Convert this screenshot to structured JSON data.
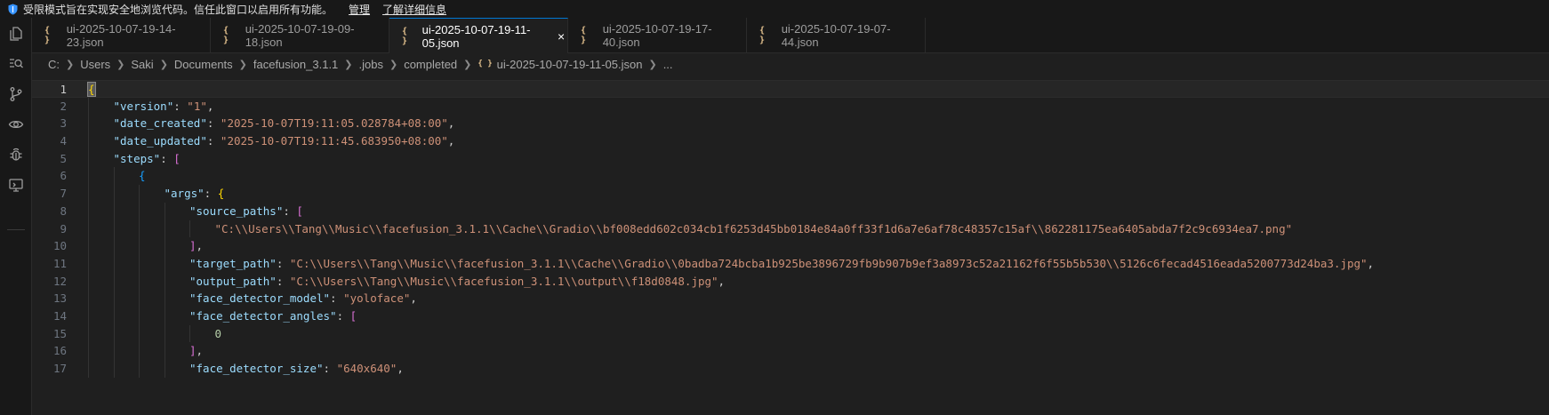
{
  "banner": {
    "message": "受限模式旨在实现安全地浏览代码。信任此窗口以启用所有功能。",
    "manage": "管理",
    "learn_more": "了解详细信息"
  },
  "activity_bar": [
    "explorer-icon",
    "search-icon",
    "source-control-icon",
    "eye-icon",
    "debug-icon",
    "remote-explorer-icon"
  ],
  "tabs": [
    {
      "label": "ui-2025-10-07-19-14-23.json",
      "active": false
    },
    {
      "label": "ui-2025-10-07-19-09-18.json",
      "active": false
    },
    {
      "label": "ui-2025-10-07-19-11-05.json",
      "active": true
    },
    {
      "label": "ui-2025-10-07-19-17-40.json",
      "active": false
    },
    {
      "label": "ui-2025-10-07-19-07-44.json",
      "active": false
    }
  ],
  "tab_icon": "{ }",
  "close_glyph": "×",
  "breadcrumb": [
    "C:",
    "Users",
    "Saki",
    "Documents",
    "facefusion_3.1.1",
    ".jobs",
    "completed",
    "ui-2025-10-07-19-11-05.json",
    "..."
  ],
  "editor": {
    "current_line": 1,
    "lines": [
      {
        "n": "1",
        "indent": 0,
        "tokens": [
          [
            "b1",
            "{"
          ]
        ]
      },
      {
        "n": "2",
        "indent": 1,
        "tokens": [
          [
            "k",
            "\"version\""
          ],
          [
            "p",
            ": "
          ],
          [
            "s",
            "\"1\""
          ],
          [
            "p",
            ","
          ]
        ]
      },
      {
        "n": "3",
        "indent": 1,
        "tokens": [
          [
            "k",
            "\"date_created\""
          ],
          [
            "p",
            ": "
          ],
          [
            "s",
            "\"2025-10-07T19:11:05.028784+08:00\""
          ],
          [
            "p",
            ","
          ]
        ]
      },
      {
        "n": "4",
        "indent": 1,
        "tokens": [
          [
            "k",
            "\"date_updated\""
          ],
          [
            "p",
            ": "
          ],
          [
            "s",
            "\"2025-10-07T19:11:45.683950+08:00\""
          ],
          [
            "p",
            ","
          ]
        ]
      },
      {
        "n": "5",
        "indent": 1,
        "tokens": [
          [
            "k",
            "\"steps\""
          ],
          [
            "p",
            ": "
          ],
          [
            "b2",
            "["
          ]
        ]
      },
      {
        "n": "6",
        "indent": 2,
        "tokens": [
          [
            "b3",
            "{"
          ]
        ]
      },
      {
        "n": "7",
        "indent": 3,
        "tokens": [
          [
            "k",
            "\"args\""
          ],
          [
            "p",
            ": "
          ],
          [
            "b1",
            "{"
          ]
        ]
      },
      {
        "n": "8",
        "indent": 4,
        "tokens": [
          [
            "k",
            "\"source_paths\""
          ],
          [
            "p",
            ": "
          ],
          [
            "b2",
            "["
          ]
        ]
      },
      {
        "n": "9",
        "indent": 5,
        "tokens": [
          [
            "s",
            "\"C:\\\\Users\\\\Tang\\\\Music\\\\facefusion_3.1.1\\\\Cache\\\\Gradio\\\\bf008edd602c034cb1f6253d45bb0184e84a0ff33f1d6a7e6af78c48357c15af\\\\862281175ea6405abda7f2c9c6934ea7.png\""
          ]
        ]
      },
      {
        "n": "10",
        "indent": 4,
        "tokens": [
          [
            "b2",
            "]"
          ],
          [
            "p",
            ","
          ]
        ]
      },
      {
        "n": "11",
        "indent": 4,
        "tokens": [
          [
            "k",
            "\"target_path\""
          ],
          [
            "p",
            ": "
          ],
          [
            "s",
            "\"C:\\\\Users\\\\Tang\\\\Music\\\\facefusion_3.1.1\\\\Cache\\\\Gradio\\\\0badba724bcba1b925be3896729fb9b907b9ef3a8973c52a21162f6f55b5b530\\\\5126c6fecad4516eada5200773d24ba3.jpg\""
          ],
          [
            "p",
            ","
          ]
        ]
      },
      {
        "n": "12",
        "indent": 4,
        "tokens": [
          [
            "k",
            "\"output_path\""
          ],
          [
            "p",
            ": "
          ],
          [
            "s",
            "\"C:\\\\Users\\\\Tang\\\\Music\\\\facefusion_3.1.1\\\\output\\\\f18d0848.jpg\""
          ],
          [
            "p",
            ","
          ]
        ]
      },
      {
        "n": "13",
        "indent": 4,
        "tokens": [
          [
            "k",
            "\"face_detector_model\""
          ],
          [
            "p",
            ": "
          ],
          [
            "s",
            "\"yoloface\""
          ],
          [
            "p",
            ","
          ]
        ]
      },
      {
        "n": "14",
        "indent": 4,
        "tokens": [
          [
            "k",
            "\"face_detector_angles\""
          ],
          [
            "p",
            ": "
          ],
          [
            "b2",
            "["
          ]
        ]
      },
      {
        "n": "15",
        "indent": 5,
        "tokens": [
          [
            "n",
            "0"
          ]
        ]
      },
      {
        "n": "16",
        "indent": 4,
        "tokens": [
          [
            "b2",
            "]"
          ],
          [
            "p",
            ","
          ]
        ]
      },
      {
        "n": "17",
        "indent": 4,
        "tokens": [
          [
            "k",
            "\"face_detector_size\""
          ],
          [
            "p",
            ": "
          ],
          [
            "s",
            "\"640x640\""
          ],
          [
            "p",
            ","
          ]
        ]
      }
    ]
  }
}
